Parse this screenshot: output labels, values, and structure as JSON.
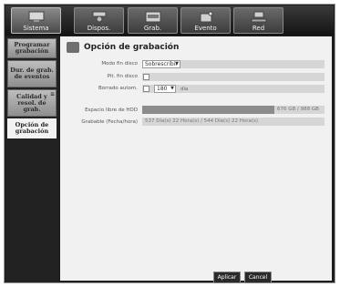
{
  "tabs": [
    {
      "label": "Sistema",
      "icon": "monitor-icon",
      "active": true
    },
    {
      "label": "Dispos.",
      "icon": "camera-icon",
      "active": false
    },
    {
      "label": "Grab.",
      "icon": "recorder-icon",
      "active": false
    },
    {
      "label": "Evento",
      "icon": "alarm-icon",
      "active": false
    },
    {
      "label": "Red",
      "icon": "network-icon",
      "active": false
    }
  ],
  "sidebar": {
    "items": [
      {
        "label": "Programar grabación",
        "active": false
      },
      {
        "label": "Dur. de grab. de eventos",
        "active": false
      },
      {
        "label": "Calidad y resol. de grab.",
        "active": false
      },
      {
        "label": "Opción de grabación",
        "active": true
      }
    ],
    "expand_mark": "≡"
  },
  "panel": {
    "title": "Opción de grabación",
    "modo_fin_disco": {
      "label": "Modo fin disco",
      "value": "Sobrescribir"
    },
    "pit_fin_disco": {
      "label": "Pit. fin disco"
    },
    "borrado_autom": {
      "label": "Borrado autom.",
      "value": "180",
      "unit": "día"
    },
    "espacio_libre": {
      "label": "Espacio libre de HDD",
      "value": "676 GB / 988 GB"
    },
    "grabable": {
      "label": "Grabable (Fecha/hora)",
      "value": "537 Día(s) 22 Hora(s) / 544 Día(s) 22 Hora(s)"
    }
  },
  "buttons": {
    "apply": "Aplicar",
    "cancel": "Cancel"
  }
}
